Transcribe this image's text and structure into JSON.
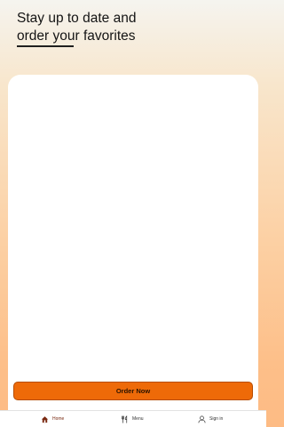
{
  "header": {
    "title_line1": "Stay up to date and",
    "title_line2": "order your favorites"
  },
  "order_button": {
    "label": "Order Now"
  },
  "bottom_nav": {
    "items": [
      {
        "label": "Home",
        "icon": "home-icon",
        "active": true
      },
      {
        "label": "Menu",
        "icon": "fork-knife-icon",
        "active": false
      },
      {
        "label": "Sign in",
        "icon": "user-icon",
        "active": false
      }
    ]
  },
  "colors": {
    "accent": "#ee6a08",
    "home_active": "#7a2a12",
    "background_top": "#f5f4ef",
    "background_bottom": "#fdbb84"
  }
}
